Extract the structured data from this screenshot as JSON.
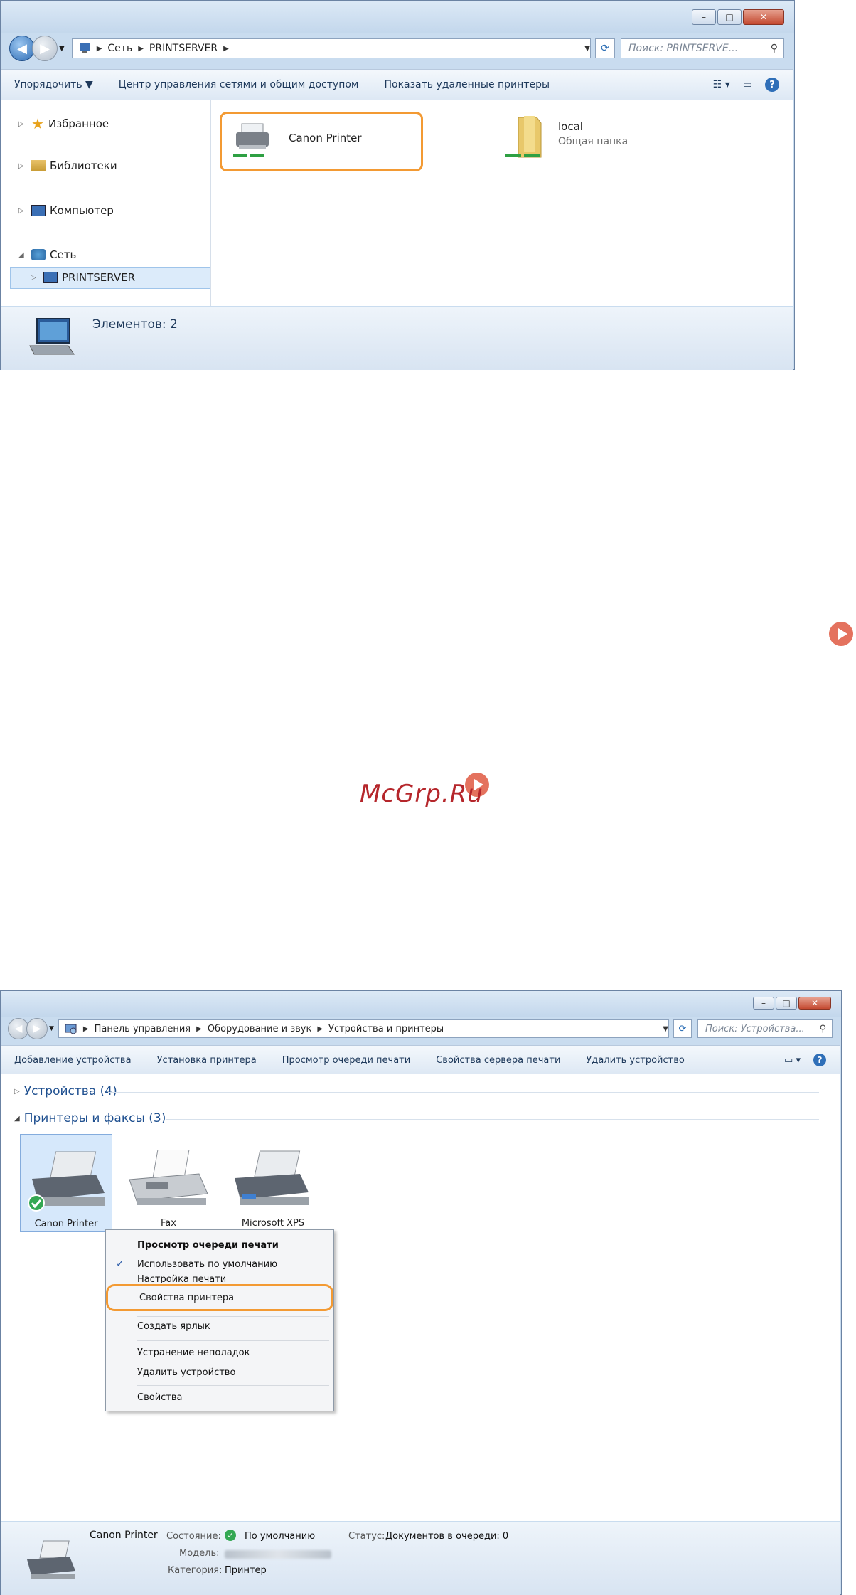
{
  "explorer": {
    "address": {
      "seg1": "Сеть",
      "seg2": "PRINTSERVER"
    },
    "search_placeholder": "Поиск: PRINTSERVE...",
    "toolbar": {
      "organize": "Упорядочить ▼",
      "network_center": "Центр управления сетями и общим доступом",
      "show_remote_printers": "Показать удаленные принтеры"
    },
    "nav": {
      "favorites": "Избранное",
      "libraries": "Библиотеки",
      "computer": "Компьютер",
      "network": "Сеть",
      "printserver": "PRINTSERVER"
    },
    "items": {
      "printer_name": "Canon Printer",
      "folder_name": "local",
      "folder_type": "Общая папка"
    },
    "status": "Элементов: 2"
  },
  "watermark": "McGrp.Ru",
  "control_panel": {
    "address": {
      "seg1": "Панель управления",
      "seg2": "Оборудование и звук",
      "seg3": "Устройства и принтеры"
    },
    "search_placeholder": "Поиск: Устройства...",
    "toolbar": {
      "add_device": "Добавление устройства",
      "add_printer": "Установка принтера",
      "view_queue": "Просмотр очереди печати",
      "server_props": "Свойства сервера печати",
      "remove_device": "Удалить устройство"
    },
    "groups": {
      "devices": "Устройства (4)",
      "printers": "Принтеры и факсы (3)"
    },
    "printers": {
      "canon": "Canon Printer",
      "fax": "Fax",
      "xps": "Microsoft XPS"
    },
    "context_menu": {
      "view_queue": "Просмотр очереди печати",
      "set_default": "Использовать по умолчанию",
      "print_prefs": "Настройка печати",
      "printer_props": "Свойства принтера",
      "create_shortcut": "Создать ярлык",
      "troubleshoot": "Устранение неполадок",
      "remove_device": "Удалить устройство",
      "properties": "Свойства"
    },
    "details": {
      "name": "Canon Printer",
      "state_label": "Состояние:",
      "state_value": "По умолчанию",
      "status_label": "Статус:",
      "status_value": "Документов в очереди: 0",
      "model_label": "Модель:",
      "category_label": "Категория:",
      "category_value": "Принтер"
    }
  },
  "colors": {
    "highlight": "#f39a33",
    "window_frame": "#c9dcef",
    "accent_link": "#1e4f8f",
    "play_button": "#e4725e"
  }
}
